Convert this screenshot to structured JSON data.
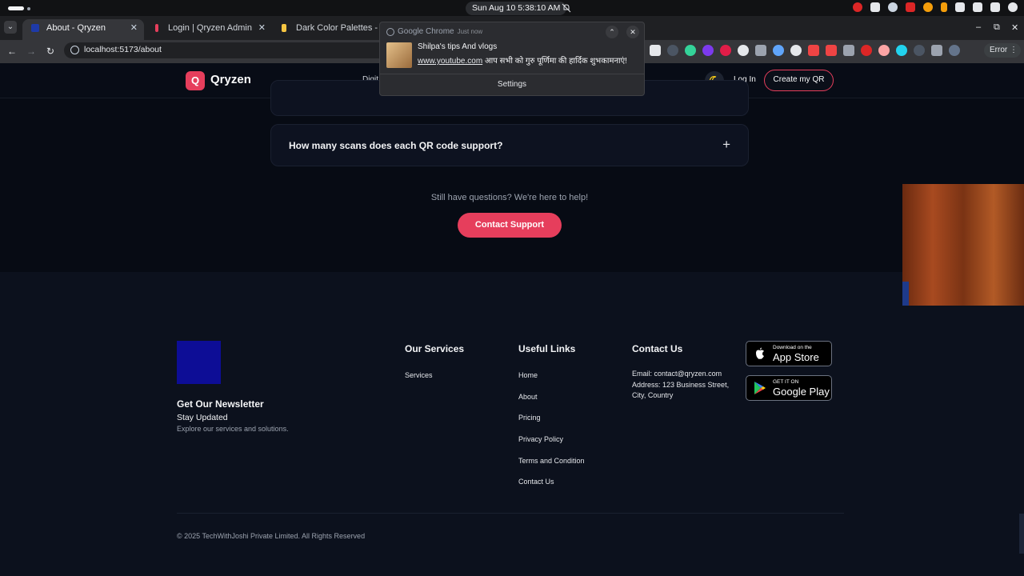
{
  "os": {
    "clock": "Sun Aug 10  5:38:10 AM"
  },
  "browser": {
    "tabs": [
      {
        "title": "About - Qryzen",
        "fav_color": "#1e3aa8",
        "active": true
      },
      {
        "title": "Login | Qryzen Admin",
        "fav_color": "#e63e5c",
        "active": false
      },
      {
        "title": "Dark Color Palettes - Co",
        "fav_color": "#f5c542",
        "active": false
      }
    ],
    "url": "localhost:5173/about",
    "error_label": "Error",
    "tab_close": "✕"
  },
  "notification": {
    "source": "Google Chrome",
    "time": "Just now",
    "title": "Shilpa's tips And vlogs",
    "link": "www.youtube.com",
    "message": "आप सभी को गुरु पूर्णिमा की हार्दिक शुभकामनाएं!",
    "settings_label": "Settings"
  },
  "header": {
    "logo_letter": "Q",
    "brand": "Qryzen",
    "nav_peek": "Digit",
    "login_label": "Log In",
    "cta_label": "Create my QR"
  },
  "faq": {
    "items": [
      {
        "question": ""
      },
      {
        "question": "How many scans does each QR code support?"
      }
    ],
    "plus": "+",
    "help_text": "Still have questions? We're here to help!",
    "support_label": "Contact Support"
  },
  "footer": {
    "newsletter_title": "Get Our Newsletter",
    "stay_updated": "Stay Updated",
    "explore": "Explore our services and solutions.",
    "services_title": "Our Services",
    "services_links": [
      "Services"
    ],
    "useful_title": "Useful Links",
    "useful_links": [
      "Home",
      "About",
      "Pricing",
      "Privacy Policy",
      "Terms and Condition",
      "Contact Us"
    ],
    "contact_title": "Contact Us",
    "email": "Email: contact@qryzen.com",
    "address": "Address: 123 Business Street, City, Country",
    "app_store_small": "Download on the",
    "app_store_big": "App Store",
    "play_small": "GET IT ON",
    "play_big": "Google Play",
    "copyright": "© 2025 TechWithJoshi Private Limited. All Rights Reserved"
  },
  "colors": {
    "accent": "#e63e5c",
    "background": "#070b14",
    "footer_bg": "#0c111d"
  }
}
